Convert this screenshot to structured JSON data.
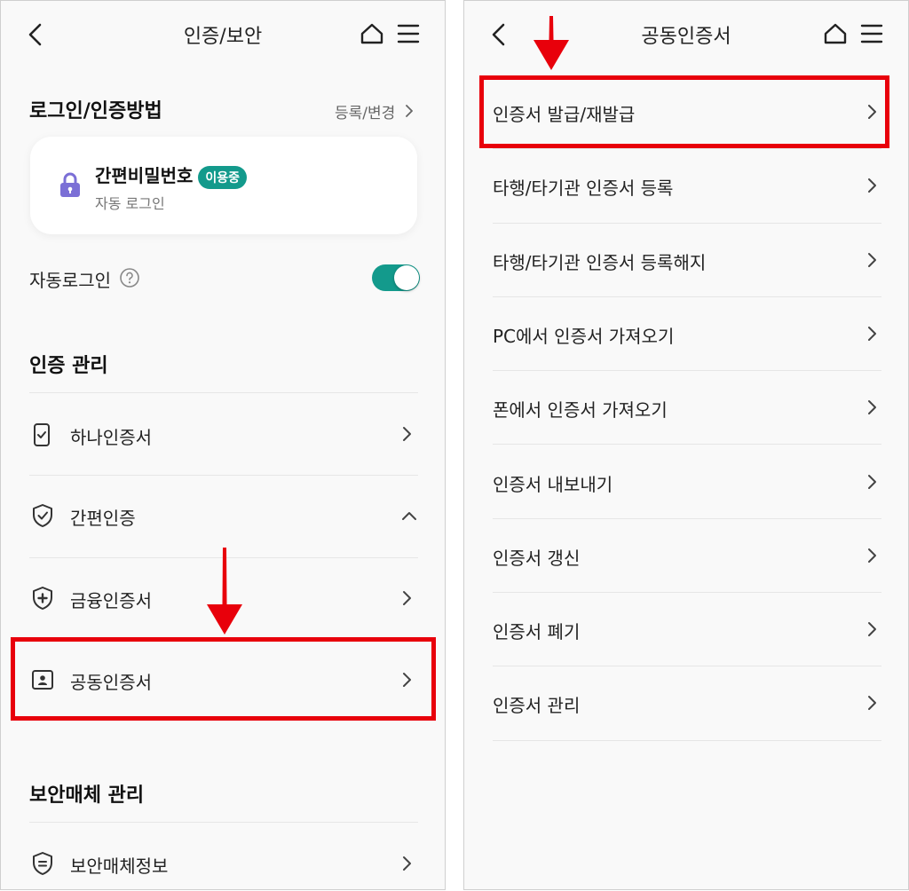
{
  "left_screen": {
    "header": {
      "title": "인증/보안",
      "back_icon": "back-arrow-icon",
      "home_icon": "home-icon",
      "menu_icon": "menu-icon"
    },
    "login_method": {
      "heading": "로그인/인증방법",
      "action_label": "등록/변경",
      "card": {
        "icon": "lock-icon",
        "title": "간편비밀번호",
        "badge": "이용중",
        "subtitle": "자동 로그인"
      },
      "auto_login": {
        "label": "자동로그인",
        "help_icon": "question-circle-icon",
        "toggle_on": true
      }
    },
    "auth_management": {
      "heading": "인증 관리",
      "items": [
        {
          "label": "하나인증서",
          "icon": "phone-check-icon",
          "chevron": "right"
        },
        {
          "label": "간편인증",
          "icon": "shield-check-icon",
          "chevron": "up"
        },
        {
          "label": "금융인증서",
          "icon": "shield-plus-icon",
          "chevron": "right"
        },
        {
          "label": "공동인증서",
          "icon": "id-card-icon",
          "chevron": "right",
          "highlighted": true
        }
      ]
    },
    "security_media": {
      "heading": "보안매체 관리",
      "items": [
        {
          "label": "보안매체정보",
          "icon": "shield-list-icon",
          "chevron": "right"
        }
      ]
    }
  },
  "right_screen": {
    "header": {
      "title": "공동인증서",
      "back_icon": "back-arrow-icon",
      "home_icon": "home-icon",
      "menu_icon": "menu-icon"
    },
    "items": [
      {
        "label": "인증서 발급/재발급",
        "highlighted": true
      },
      {
        "label": "타행/타기관 인증서 등록"
      },
      {
        "label": "타행/타기관 인증서 등록해지"
      },
      {
        "label": "PC에서 인증서 가져오기"
      },
      {
        "label": "폰에서 인증서 가져오기"
      },
      {
        "label": "인증서 내보내기"
      },
      {
        "label": "인증서 갱신"
      },
      {
        "label": "인증서 폐기"
      },
      {
        "label": "인증서 관리"
      }
    ]
  },
  "colors": {
    "accent": "#139a8c",
    "highlight": "#e8000b",
    "arrow": "#e8000b",
    "lock": "#7b6fd6"
  }
}
